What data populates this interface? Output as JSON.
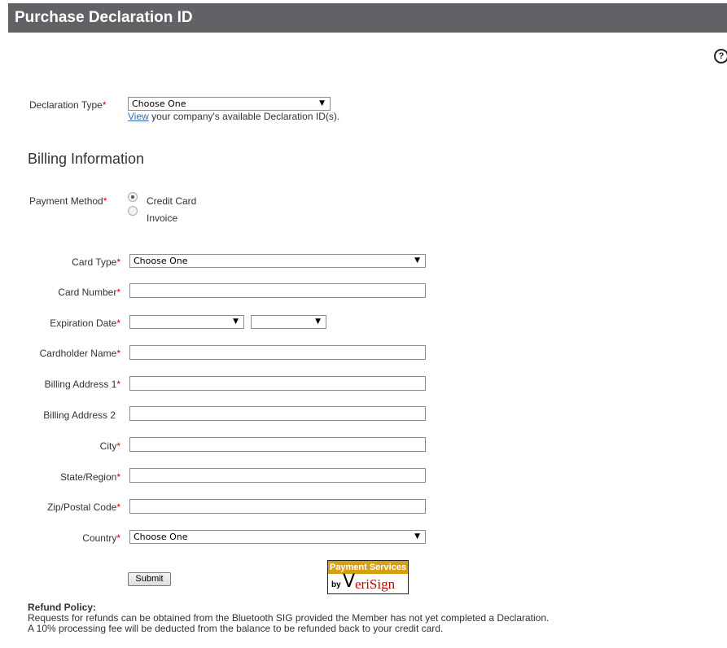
{
  "header": {
    "title": "Purchase Declaration ID"
  },
  "help_icon": "help-circle-icon",
  "declaration": {
    "label": "Declaration Type",
    "select_value": "Choose One",
    "link_text": "View",
    "link_suffix": " your company's available Declaration ID(s)."
  },
  "billing": {
    "heading": "Billing Information",
    "payment_label": "Payment Method",
    "options": [
      {
        "label": "Credit Card",
        "selected": true
      },
      {
        "label": "Invoice",
        "selected": false
      }
    ]
  },
  "fields": {
    "card_type": {
      "label": "Card Type",
      "value": "Choose One"
    },
    "card_number": {
      "label": "Card Number",
      "value": ""
    },
    "expiration": {
      "label": "Expiration Date",
      "month": "",
      "year": ""
    },
    "cardholder": {
      "label": "Cardholder Name",
      "value": ""
    },
    "address1": {
      "label": "Billing Address 1",
      "value": ""
    },
    "address2": {
      "label": "Billing Address 2",
      "value": ""
    },
    "city": {
      "label": "City",
      "value": ""
    },
    "state": {
      "label": "State/Region",
      "value": ""
    },
    "zip": {
      "label": "Zip/Postal Code",
      "value": ""
    },
    "country": {
      "label": "Country",
      "value": "Choose One"
    }
  },
  "required_mark": "*",
  "submit_label": "Submit",
  "verisign": {
    "top": "Payment Services",
    "by": "by",
    "name": "eriSign",
    "check": "V"
  },
  "refund": {
    "heading": "Refund Policy:",
    "line1": "Requests for refunds can be obtained from the Bluetooth SIG provided the Member has not yet completed a Declaration.",
    "line2": "A 10% processing fee will be deducted from the balance to be refunded back to your credit card."
  },
  "colors": {
    "header_bg": "#616265",
    "required": "#cc0000",
    "link": "#2a6ebb",
    "verisign_gold": "#d6a015"
  }
}
